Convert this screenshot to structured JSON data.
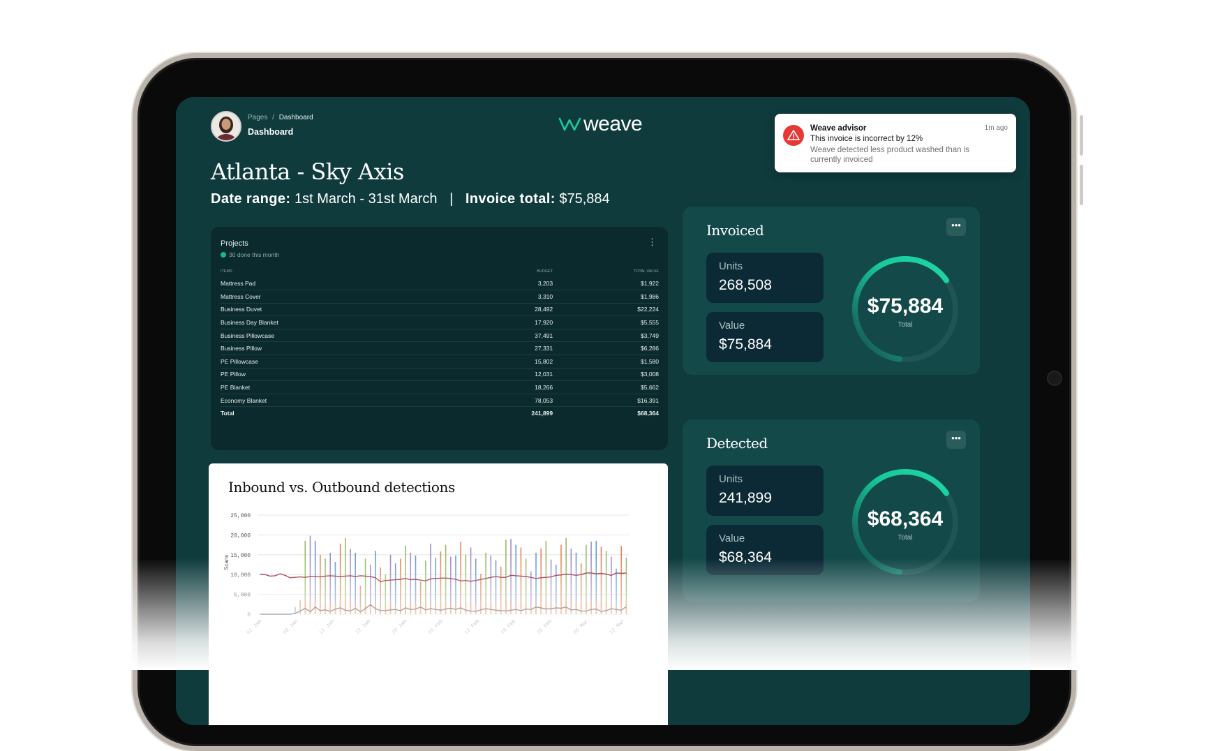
{
  "header": {
    "breadcrumb_root": "Pages",
    "breadcrumb_sep": "/",
    "breadcrumb_current": "Dashboard",
    "page_title": "Dashboard",
    "logo_text": "weave"
  },
  "site": {
    "title": "Atlanta - Sky Axis",
    "date_range_label": "Date range:",
    "date_range_value": "1st March - 31st March",
    "separator": "|",
    "invoice_total_label": "Invoice total:",
    "invoice_total_value": "$75,884"
  },
  "advisor": {
    "title": "Weave advisor",
    "message": "This invoice is incorrect by 12%",
    "detail": "Weave detected less product washed than is currently invoiced",
    "time": "1m ago"
  },
  "projects": {
    "title": "Projects",
    "subtitle": "30 done this month",
    "columns": [
      "ITEMS",
      "BUDGET",
      "TOTAL VALUE"
    ],
    "rows": [
      [
        "Mattress Pad",
        "3,203",
        "$1,922"
      ],
      [
        "Mattress Cover",
        "3,310",
        "$1,986"
      ],
      [
        "Business Duvet",
        "28,492",
        "$22,224"
      ],
      [
        "Business Day Blanket",
        "17,920",
        "$5,555"
      ],
      [
        "Business Pillowcase",
        "37,491",
        "$3,749"
      ],
      [
        "Business Pillow",
        "27,331",
        "$6,286"
      ],
      [
        "PE Pillowcase",
        "15,802",
        "$1,580"
      ],
      [
        "PE Pillow",
        "12,031",
        "$3,008"
      ],
      [
        "PE Blanket",
        "18,266",
        "$5,662"
      ],
      [
        "Economy Blanket",
        "78,053",
        "$16,391"
      ]
    ],
    "total": [
      "Total",
      "241,899",
      "$68,364"
    ]
  },
  "invoiced": {
    "title": "Invoiced",
    "units_label": "Units",
    "units_value": "268,508",
    "value_label": "Value",
    "value_value": "$75,884",
    "gauge_value": "$75,884",
    "gauge_label": "Total",
    "gauge_fraction": 0.36
  },
  "detected": {
    "title": "Detected",
    "units_label": "Units",
    "units_value": "241,899",
    "value_label": "Value",
    "value_value": "$68,364",
    "gauge_value": "$68,364",
    "gauge_label": "Total",
    "gauge_fraction": 0.36
  },
  "chart_data": {
    "type": "bar",
    "title": "Inbound vs. Outbound detections",
    "ylabel": "Scans",
    "xlabel": "",
    "ylim": [
      0,
      25000
    ],
    "yticks": [
      "25,000",
      "20,000",
      "15,000",
      "10,000",
      "5,000",
      "0"
    ],
    "xticks": [
      "01 Jan",
      "08 Jan",
      "15 Jan",
      "22 Jan",
      "29 Jan",
      "05 Feb",
      "12 Feb",
      "19 Feb",
      "26 Feb",
      "05 Mar",
      "12 Mar"
    ],
    "bar_values": [
      0,
      0,
      0,
      0,
      0,
      0,
      0,
      1800,
      3500,
      18500,
      19800,
      18500,
      15000,
      14000,
      15500,
      13200,
      17800,
      19200,
      16500,
      15500,
      7200,
      14000,
      12500,
      16000,
      11800,
      10000,
      15000,
      12800,
      14000,
      17300,
      15500,
      14800,
      8200,
      13500,
      17800,
      14200,
      15800,
      17500,
      14500,
      14800,
      18300,
      15000,
      16800,
      14000,
      10200,
      15500,
      14800,
      13600,
      12000,
      18800,
      19000,
      17500,
      16800,
      14000,
      10800,
      15500,
      16600,
      18500,
      13800,
      12500,
      17500,
      19200,
      16500,
      15500,
      12800,
      17500,
      18300,
      18500,
      17000,
      16000,
      14500,
      11500,
      17200,
      14200
    ],
    "line_red": [
      10100,
      10000,
      9600,
      9700,
      10200,
      9800,
      9200,
      9300,
      9400,
      9300,
      9500,
      9500,
      9400,
      9600,
      9700,
      9600,
      9500,
      9600,
      9700,
      9500,
      9700,
      9600,
      9500,
      9200,
      8200,
      8500,
      8600,
      8700,
      8800,
      9000,
      8700,
      8800,
      8600,
      8400,
      8900,
      9000,
      9100,
      9100,
      9000,
      8800,
      8400,
      8500,
      8300,
      8500,
      8800,
      9000,
      9300,
      9500,
      9300,
      9300,
      9800,
      9700,
      9600,
      9500,
      9300,
      9000,
      9200,
      9300,
      9400,
      9800,
      9900,
      10100,
      10000,
      9800,
      10000,
      10400,
      10400,
      10200,
      10300,
      10100,
      9800,
      10400,
      10300,
      10400
    ],
    "line_dark": [
      0,
      0,
      0,
      0,
      0,
      0,
      0,
      200,
      800,
      1500,
      600,
      1800,
      900,
      1100,
      700,
      1300,
      1600,
      1000,
      800,
      1500,
      600,
      1400,
      2400,
      1400,
      900,
      900,
      1100,
      1200,
      900,
      1600,
      1200,
      1300,
      1800,
      1100,
      1400,
      1200,
      1000,
      1300,
      1500,
      1200,
      1600,
      1000,
      800,
      700,
      1100,
      1400,
      1200,
      1000,
      900,
      800,
      1000,
      1200,
      900,
      1300,
      1200,
      1800,
      1600,
      1300,
      1400,
      1600,
      1500,
      1800,
      1100,
      1200,
      800,
      800,
      1200,
      1300,
      700,
      900,
      1400,
      1200,
      1000,
      1900
    ]
  }
}
